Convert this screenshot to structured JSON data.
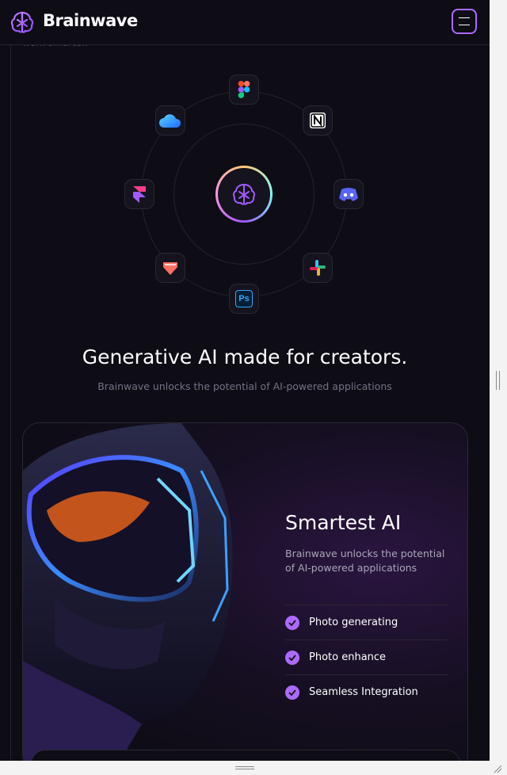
{
  "header": {
    "brand": "Brainwave"
  },
  "intro_fragment": "work smarter.",
  "integrations": {
    "apps": [
      {
        "name": "figma-icon"
      },
      {
        "name": "notion-icon"
      },
      {
        "name": "discord-icon"
      },
      {
        "name": "slack-icon"
      },
      {
        "name": "photoshop-icon",
        "label": "Ps"
      },
      {
        "name": "protopie-icon"
      },
      {
        "name": "framer-icon"
      },
      {
        "name": "raindrop-icon"
      }
    ],
    "headline": "Generative AI made for creators.",
    "subline": "Brainwave unlocks the potential of AI-powered applications"
  },
  "feature_card": {
    "title": "Smartest AI",
    "description": "Brainwave unlocks the potential of AI-powered applications",
    "items": [
      {
        "label": "Photo generating"
      },
      {
        "label": "Photo enhance"
      },
      {
        "label": "Seamless Integration"
      }
    ]
  },
  "colors": {
    "background": "#0e0c15",
    "accent": "#ac6aff",
    "muted_text": "#757185",
    "border": "#26242c"
  }
}
